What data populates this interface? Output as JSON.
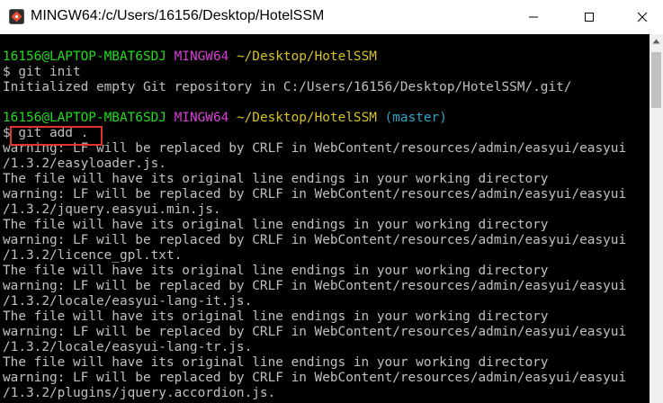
{
  "window": {
    "title": "MINGW64:/c/Users/16156/Desktop/HotelSSM"
  },
  "titlebar_buttons": {
    "minimize_icon": "minimize-icon",
    "maximize_icon": "maximize-icon",
    "close_icon": "close-icon"
  },
  "terminal": {
    "prompt1": {
      "user": "16156@LAPTOP-MBAT6SDJ",
      "env": "MINGW64",
      "path": "~/Desktop/HotelSSM"
    },
    "cmd1": "$ git init",
    "out1": "Initialized empty Git repository in C:/Users/16156/Desktop/HotelSSM/.git/",
    "prompt2": {
      "user": "16156@LAPTOP-MBAT6SDJ",
      "env": "MINGW64",
      "path": "~/Desktop/HotelSSM",
      "branch": "(master)"
    },
    "cmd2": "$ git add .",
    "output_lines": [
      "warning: LF will be replaced by CRLF in WebContent/resources/admin/easyui/easyui",
      "/1.3.2/easyloader.js.",
      "The file will have its original line endings in your working directory",
      "warning: LF will be replaced by CRLF in WebContent/resources/admin/easyui/easyui",
      "/1.3.2/jquery.easyui.min.js.",
      "The file will have its original line endings in your working directory",
      "warning: LF will be replaced by CRLF in WebContent/resources/admin/easyui/easyui",
      "/1.3.2/licence_gpl.txt.",
      "The file will have its original line endings in your working directory",
      "warning: LF will be replaced by CRLF in WebContent/resources/admin/easyui/easyui",
      "/1.3.2/locale/easyui-lang-it.js.",
      "The file will have its original line endings in your working directory",
      "warning: LF will be replaced by CRLF in WebContent/resources/admin/easyui/easyui",
      "/1.3.2/locale/easyui-lang-tr.js.",
      "The file will have its original line endings in your working directory",
      "warning: LF will be replaced by CRLF in WebContent/resources/admin/easyui/easyui",
      "/1.3.2/plugins/jquery.accordion.js."
    ]
  },
  "colors": {
    "user_host": "#1cdc1c",
    "env": "#d63fd6",
    "path": "#d6c41c",
    "branch": "#2aa5c8",
    "text": "#c0c0c0",
    "highlight_box": "#e0332c",
    "background": "#000000"
  }
}
